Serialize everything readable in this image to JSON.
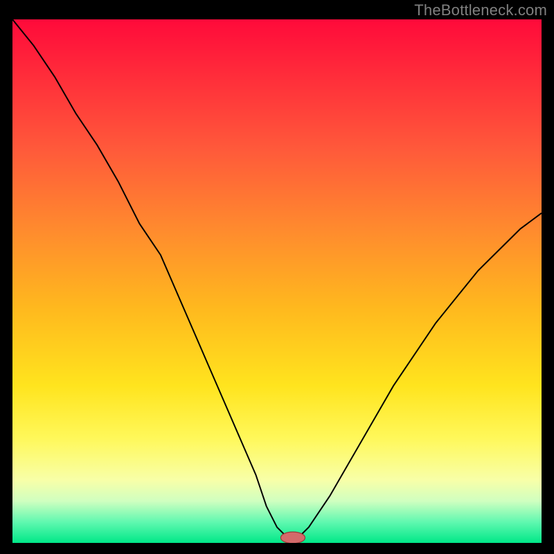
{
  "watermark": "TheBottleneck.com",
  "colors": {
    "gradient_stops": [
      {
        "offset": 0.0,
        "color": "#ff0a3a"
      },
      {
        "offset": 0.1,
        "color": "#ff2a3a"
      },
      {
        "offset": 0.25,
        "color": "#ff5a3a"
      },
      {
        "offset": 0.4,
        "color": "#ff8a2e"
      },
      {
        "offset": 0.55,
        "color": "#ffb81e"
      },
      {
        "offset": 0.7,
        "color": "#ffe41e"
      },
      {
        "offset": 0.8,
        "color": "#fff85a"
      },
      {
        "offset": 0.88,
        "color": "#f8ffa8"
      },
      {
        "offset": 0.92,
        "color": "#d0ffc0"
      },
      {
        "offset": 0.96,
        "color": "#60f8b0"
      },
      {
        "offset": 1.0,
        "color": "#00e888"
      }
    ],
    "curve": "#000000",
    "marker_fill": "#d46a6a",
    "marker_stroke": "#9a3838"
  },
  "chart_data": {
    "type": "line",
    "title": "",
    "xlabel": "",
    "ylabel": "",
    "xlim": [
      0,
      100
    ],
    "ylim": [
      0,
      100
    ],
    "x": [
      0,
      4,
      8,
      12,
      16,
      20,
      24,
      28,
      31,
      34,
      37,
      40,
      43,
      46,
      48,
      50,
      52,
      54,
      56,
      60,
      64,
      68,
      72,
      76,
      80,
      84,
      88,
      92,
      96,
      100
    ],
    "y": [
      100,
      95,
      89,
      82,
      76,
      69,
      61,
      55,
      48,
      41,
      34,
      27,
      20,
      13,
      7,
      3,
      1,
      1,
      3,
      9,
      16,
      23,
      30,
      36,
      42,
      47,
      52,
      56,
      60,
      63
    ],
    "flat_bottom": {
      "x_start": 50,
      "x_end": 54,
      "y": 1
    },
    "marker": {
      "x": 53,
      "y": 1,
      "rx": 2.3,
      "ry": 1.1
    }
  }
}
